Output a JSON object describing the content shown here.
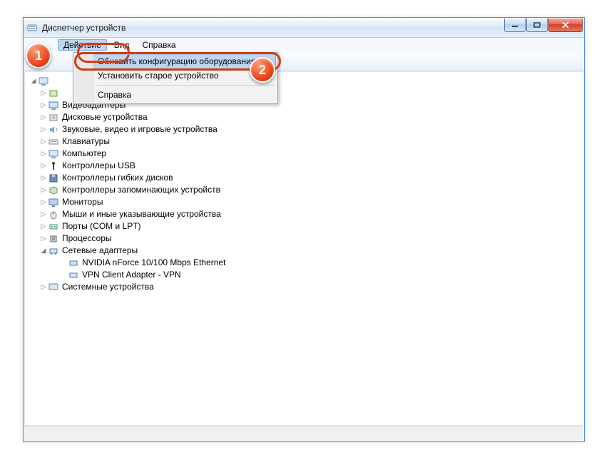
{
  "window": {
    "title": "Диспетчер устройств"
  },
  "menubar": {
    "file_hidden": "",
    "action": "Действие",
    "view": "Вид",
    "help": "Справка"
  },
  "dropdown": {
    "refresh": "Обновить конфигурацию оборудования",
    "install_legacy": "Установить старое устройство",
    "help": "Справка"
  },
  "tree": {
    "items": [
      {
        "label": "Видеоадаптеры",
        "icon": "display"
      },
      {
        "label": "Дисковые устройства",
        "icon": "disk"
      },
      {
        "label": "Звуковые, видео и игровые устройства",
        "icon": "sound"
      },
      {
        "label": "Клавиатуры",
        "icon": "keyboard"
      },
      {
        "label": "Компьютер",
        "icon": "computer"
      },
      {
        "label": "Контроллеры USB",
        "icon": "usb"
      },
      {
        "label": "Контроллеры гибких дисков",
        "icon": "floppy"
      },
      {
        "label": "Контроллеры запоминающих устройств",
        "icon": "storage"
      },
      {
        "label": "Мониторы",
        "icon": "monitor"
      },
      {
        "label": "Мыши и иные указывающие устройства",
        "icon": "mouse"
      },
      {
        "label": "Порты (COM и LPT)",
        "icon": "port"
      },
      {
        "label": "Процессоры",
        "icon": "cpu"
      }
    ],
    "network": {
      "label": "Сетевые адаптеры",
      "children": [
        "NVIDIA nForce 10/100 Mbps Ethernet",
        "VPN Client Adapter - VPN"
      ]
    },
    "system": {
      "label": "Системные устройства"
    }
  },
  "callouts": {
    "c1": "1",
    "c2": "2"
  }
}
